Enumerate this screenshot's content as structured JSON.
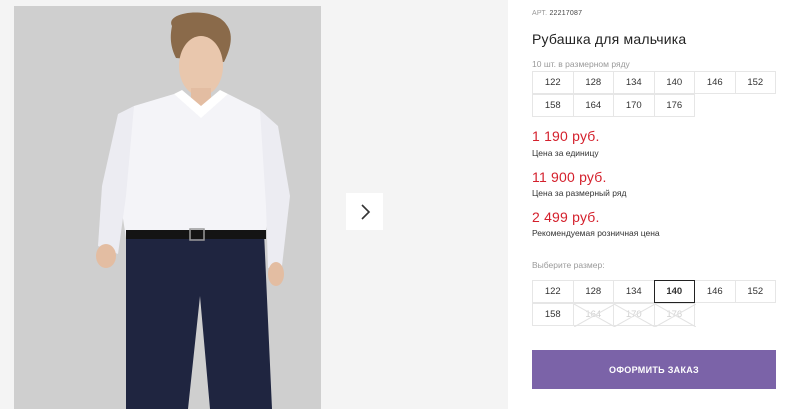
{
  "gallery": {
    "image_alt": "Boy in white shirt and navy trousers",
    "next_icon": "chevron-right-icon"
  },
  "product": {
    "article_prefix": "АРТ.",
    "article_number": "22217087",
    "title": "Рубашка для мальчика"
  },
  "pack": {
    "label": "10 шт. в размерном ряду",
    "sizes_row1": [
      "122",
      "128",
      "134",
      "140",
      "146",
      "152"
    ],
    "sizes_row2": [
      "158",
      "164",
      "170",
      "176"
    ]
  },
  "prices": {
    "unit_price": "1 190 руб.",
    "unit_label": "Цена за единицу",
    "pack_price": "11 900 руб.",
    "pack_label": "Цена за размерный ряд",
    "retail_price": "2 499 руб.",
    "retail_label": "Рекомендуемая розничная цена",
    "price_color": "#d4202c"
  },
  "size_picker": {
    "label": "Выберите размер:",
    "row1": [
      "122",
      "128",
      "134",
      "140",
      "146",
      "152"
    ],
    "row2": [
      "158",
      "164",
      "170",
      "176"
    ],
    "selected": "140",
    "disabled": [
      "164",
      "170",
      "176"
    ]
  },
  "order_button": {
    "label": "ОФОРМИТЬ ЗАКАЗ",
    "color": "#7b63a8"
  }
}
